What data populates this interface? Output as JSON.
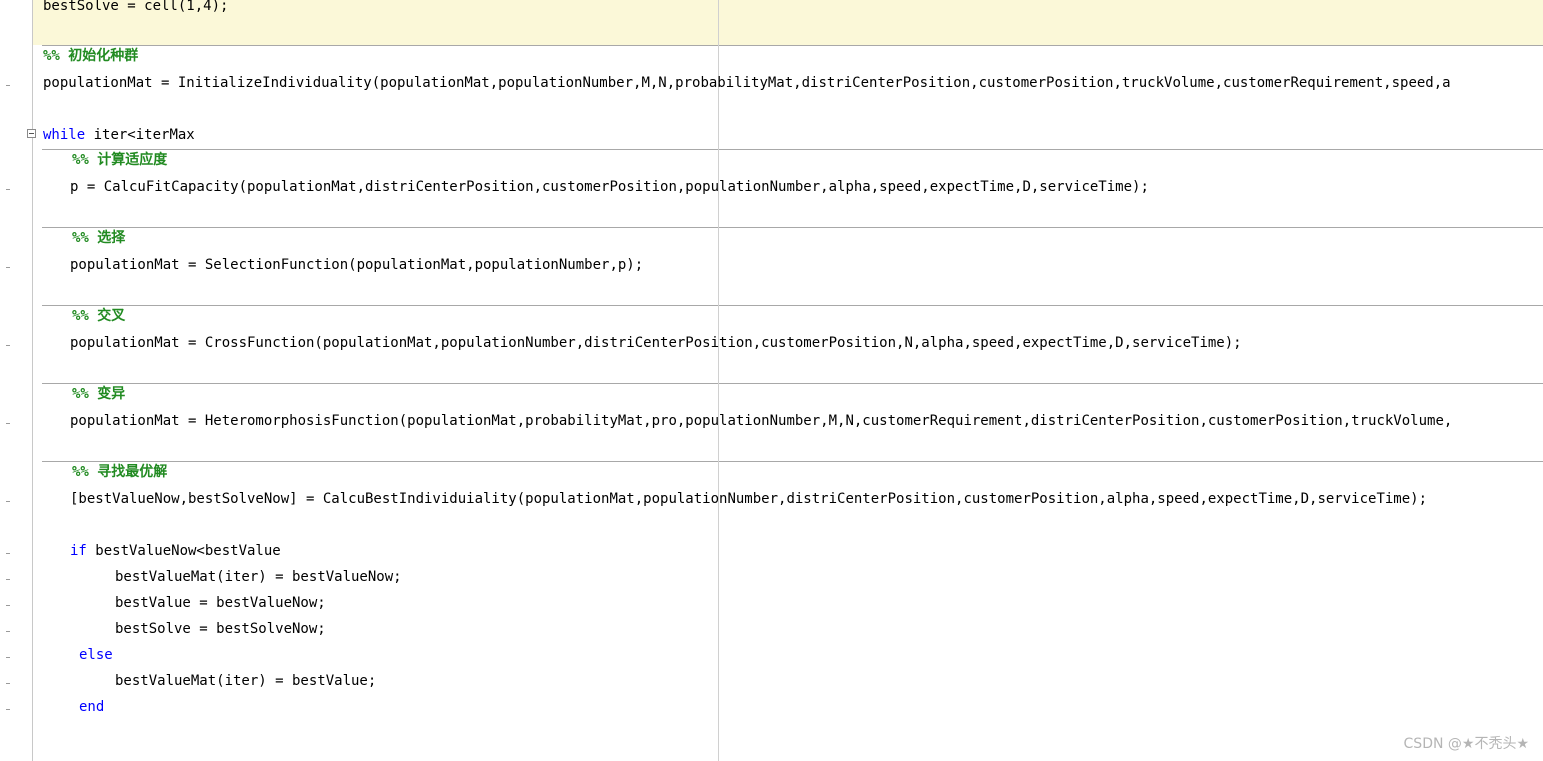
{
  "editor": {
    "lines": [
      {
        "text": "bestSolve = cell(1,4);"
      },
      {
        "text": "%% 初始化种群"
      },
      {
        "text": "populationMat = InitializeIndividuality(populationMat,populationNumber,M,N,probabilityMat,distriCenterPosition,customerPosition,truckVolume,customerRequirement,speed,a"
      },
      {
        "keyword": "while",
        "text": " iter<iterMax"
      },
      {
        "text": "%% 计算适应度"
      },
      {
        "text": "p = CalcuFitCapacity(populationMat,distriCenterPosition,customerPosition,populationNumber,alpha,speed,expectTime,D,serviceTime);"
      },
      {
        "text": "%% 选择"
      },
      {
        "text": "populationMat = SelectionFunction(populationMat,populationNumber,p);"
      },
      {
        "text": "%% 交叉"
      },
      {
        "text": "populationMat = CrossFunction(populationMat,populationNumber,distriCenterPosition,customerPosition,N,alpha,speed,expectTime,D,serviceTime);"
      },
      {
        "text": "%% 变异"
      },
      {
        "text": "populationMat = HeteromorphosisFunction(populationMat,probabilityMat,pro,populationNumber,M,N,customerRequirement,distriCenterPosition,customerPosition,truckVolume,"
      },
      {
        "text": "%% 寻找最优解"
      },
      {
        "text": "[bestValueNow,bestSolveNow] = CalcuBestIndividuiality(populationMat,populationNumber,distriCenterPosition,customerPosition,alpha,speed,expectTime,D,serviceTime);"
      },
      {
        "keyword": "if",
        "text": " bestValueNow<bestValue"
      },
      {
        "text": "bestValueMat(iter) = bestValueNow;"
      },
      {
        "text": "bestValue = bestValueNow;"
      },
      {
        "text": "bestSolve = bestSolveNow;"
      },
      {
        "keyword": "else",
        "text": ""
      },
      {
        "text": "bestValueMat(iter) = bestValue;"
      },
      {
        "keyword": "end",
        "text": ""
      }
    ]
  },
  "watermark": "CSDN @★不秃头★",
  "colors": {
    "keyword": "#0000ff",
    "cell_title": "#228b22",
    "current_cell_background": "#fbf8d8",
    "divider": "#a8a8a8"
  }
}
